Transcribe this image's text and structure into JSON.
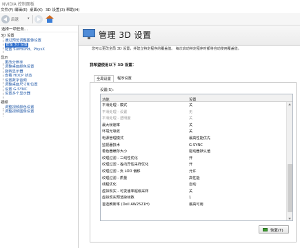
{
  "app": {
    "title": "NVIDIA 控制面板"
  },
  "menu": [
    "文件(F)",
    "编辑(E)",
    "桌面(K)",
    "3D 设置(3)",
    "帮助(H)"
  ],
  "toolbar": {
    "back_label": "后退",
    "back_dropdown": "▾"
  },
  "sidebar": {
    "header": "选择一项任务...",
    "items": [
      {
        "type": "cat",
        "label": "3D 设置"
      },
      {
        "type": "link",
        "label": "通过预览调整图像设置"
      },
      {
        "type": "sel",
        "label": "管理 3D 设置"
      },
      {
        "type": "link",
        "label": "配置 Surround、PhysX"
      },
      {
        "type": "cat",
        "label": "显示"
      },
      {
        "type": "link",
        "label": "更改分辨率"
      },
      {
        "type": "link",
        "label": "调整桌面颜色设置"
      },
      {
        "type": "link",
        "label": "旋转显示器"
      },
      {
        "type": "link",
        "label": "查看 HDCP 状态"
      },
      {
        "type": "link",
        "label": "设置数字音频"
      },
      {
        "type": "link",
        "label": "调整桌面尺寸和位置"
      },
      {
        "type": "link",
        "label": "设置 G-SYNC"
      },
      {
        "type": "link",
        "label": "设置多个显示器"
      },
      {
        "type": "cat",
        "label": "视频"
      },
      {
        "type": "link",
        "label": "调整视频颜色设置"
      },
      {
        "type": "link",
        "label": "调整视频图像设置"
      }
    ]
  },
  "main": {
    "banner_title": "管理 3D 设置",
    "description": "您可以更改全局 3D 设置，并建立特定程序的覆盖值。 每次启动特定程序时都将自动使用覆盖值。",
    "section_label": "我希望使用以下 3D 设置：",
    "tabs": [
      {
        "label": "全局设置",
        "active": true
      },
      {
        "label": "程序设置",
        "active": false
      }
    ],
    "settings_label": "设置(S):",
    "columns": [
      "功能",
      "设置"
    ],
    "rows": [
      {
        "feature": "平滑处理 - 模式",
        "value": "关",
        "dim": false
      },
      {
        "feature": "平滑处理 - 设置",
        "value": "无",
        "dim": true
      },
      {
        "feature": "平滑处理 - 透明度",
        "value": "关",
        "dim": true
      },
      {
        "feature": "最大帧速率",
        "value": "关",
        "dim": false
      },
      {
        "feature": "环境光吸收",
        "value": "关",
        "dim": false
      },
      {
        "feature": "电源管理模式",
        "value": "最高性能优先",
        "dim": false
      },
      {
        "feature": "监视器技术",
        "value": "G-SYNC",
        "dim": false
      },
      {
        "feature": "着色器缓存大小",
        "value": "驱动器默认值",
        "dim": false
      },
      {
        "feature": "纹理过滤 - 三线性优化",
        "value": "开",
        "dim": false
      },
      {
        "feature": "纹理过滤 - 各向异性采样优化",
        "value": "开",
        "dim": false
      },
      {
        "feature": "纹理过滤 - 负 LOD 偏移",
        "value": "允许",
        "dim": false
      },
      {
        "feature": "纹理过滤 - 质量",
        "value": "高性能",
        "dim": false
      },
      {
        "feature": "线程优化",
        "value": "自动",
        "dim": false
      },
      {
        "feature": "虚拟现实 - 可变速率超级采样",
        "value": "关",
        "dim": false
      },
      {
        "feature": "虚拟现实预渲染帧数",
        "value": "1",
        "dim": false
      },
      {
        "feature": "首选刷新率 (Dell AW2521H)",
        "value": "最高可用",
        "dim": false
      }
    ],
    "restore_label": "恢复(T)"
  }
}
